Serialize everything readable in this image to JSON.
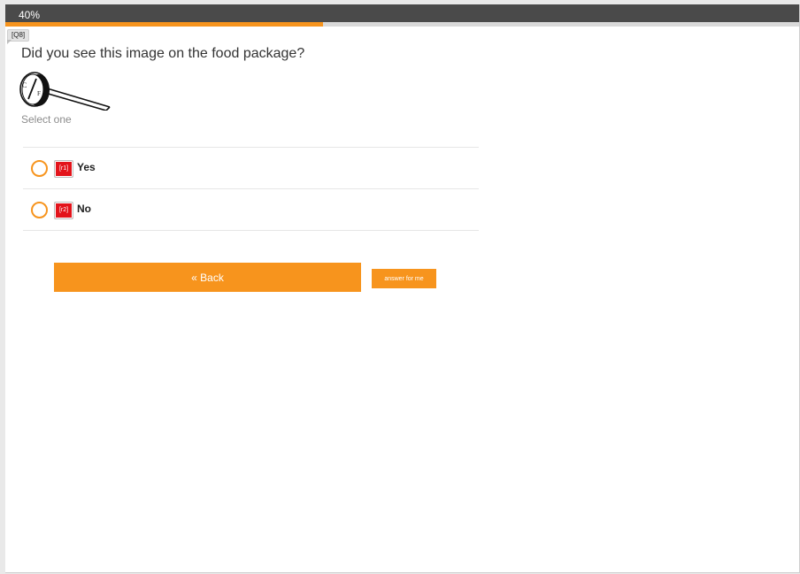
{
  "progress": {
    "label": "40%",
    "fraction": 0.4
  },
  "question": {
    "id_tag": "[Q8]",
    "text": "Did you see this image on the food package?",
    "image_icon": "meat-thermometer-icon",
    "instructions": "Select one"
  },
  "options": [
    {
      "tag": "[r1]",
      "label": "Yes"
    },
    {
      "tag": "[r2]",
      "label": "No"
    }
  ],
  "buttons": {
    "back_label": "« Back",
    "answer_for_me_label": "answer for me"
  },
  "colors": {
    "accent": "#f7941d",
    "header": "#4a4a4a",
    "tag_red": "#e3141b"
  }
}
